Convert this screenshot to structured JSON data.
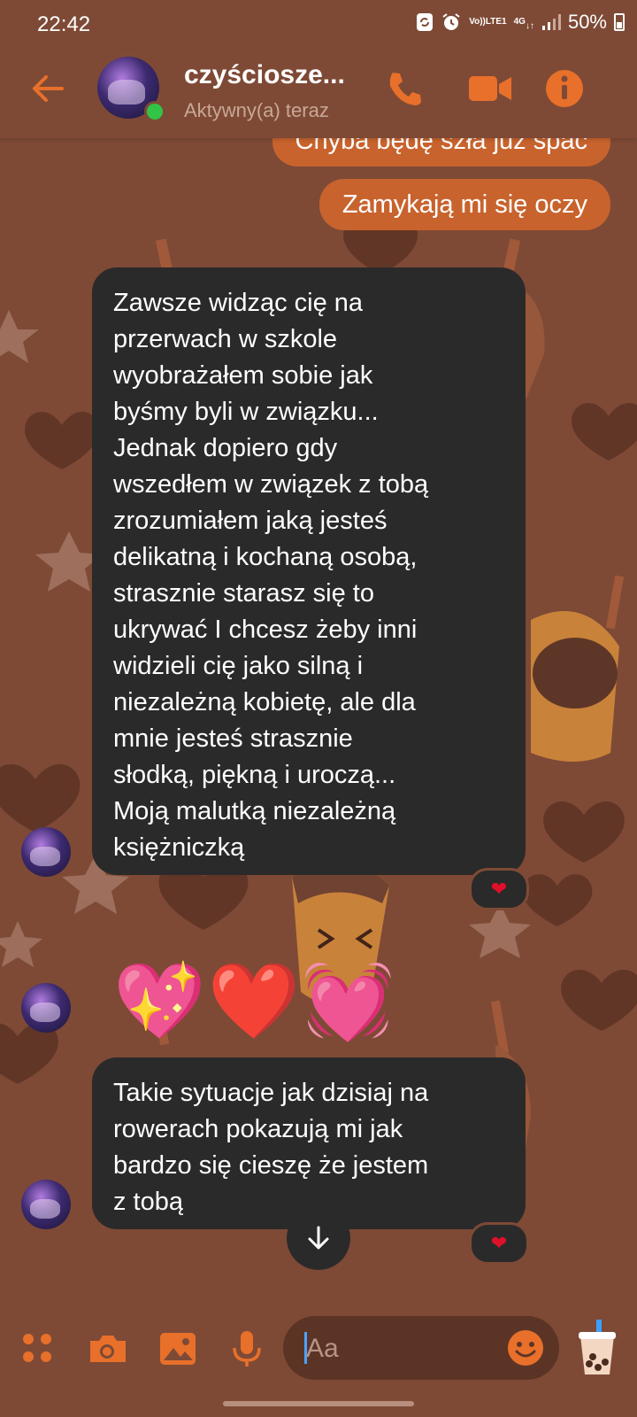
{
  "status_bar": {
    "time": "22:42",
    "network_top": "Vo))",
    "network_bottom": "LTE1",
    "network_type": "4G",
    "battery": "50%",
    "icons": [
      "sync-icon",
      "alarm-icon",
      "signal-icon",
      "battery-icon"
    ]
  },
  "header": {
    "contact_name": "czyściosze...",
    "contact_status": "Aktywny(a) teraz",
    "accent_color": "#e8702a",
    "icons": [
      "back-arrow-icon",
      "phone-icon",
      "video-camera-icon",
      "info-icon"
    ]
  },
  "messages": [
    {
      "direction": "outgoing",
      "text": "Chyba będę szła już spać"
    },
    {
      "direction": "outgoing",
      "text": "Zamykają mi się oczy"
    },
    {
      "direction": "incoming",
      "text": "Zawsze widząc cię na\nprzerwach w szkole\nwyobrażałem sobie jak\nbyśmy byli w związku...\nJednak dopiero gdy\nwszedłem w związek z tobą\nzrozumiałem jaką jesteś\ndelikatną i kochaną osobą,\nstrasznie starasz się to\nukrywać I chcesz żeby inni\nwidzieli cię jako silną i\nniezależną kobietę, ale dla\nmnie jesteś strasznie\nsłodką, piękną i uroczą...\nMoją malutką niezależną\nksiężniczką",
      "reaction": "❤"
    },
    {
      "direction": "incoming",
      "text": "💖❤️💓"
    },
    {
      "direction": "incoming",
      "text": "Takie sytuacje jak dzisiaj na\nrowerach pokazują mi jak\nbardzo się cieszę że jestem\nz tobą",
      "reaction": "❤"
    }
  ],
  "composer": {
    "placeholder": "Aa",
    "icons": [
      "apps-grid-icon",
      "camera-icon",
      "gallery-icon",
      "microphone-icon",
      "emoji-icon",
      "bubble-tea-sticker-icon"
    ]
  },
  "colors": {
    "background": "#7e4a36",
    "outgoing_bubble": "#c8632d",
    "incoming_bubble": "#2b2a2a",
    "reaction_heart": "#e0102a",
    "online_dot": "#31c447"
  }
}
